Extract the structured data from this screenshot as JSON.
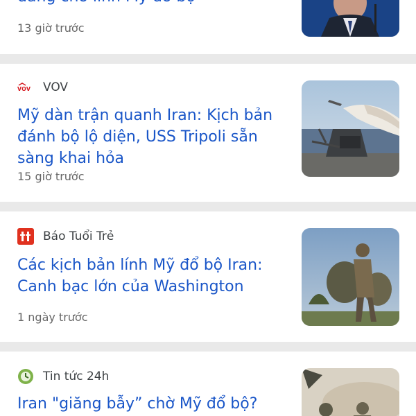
{
  "articles": [
    {
      "source": "",
      "headline": "đang cho lính Mỹ đổ bộ",
      "time": "13 giờ trước",
      "image": "man-in-suit-at-microphone"
    },
    {
      "source": "VOV",
      "source_icon": "vov-logo-icon",
      "headline": "Mỹ dàn trận quanh Iran: Kịch bản đánh bộ lộ diện, USS Tripoli sẵn sàng khai hỏa",
      "time": "15 giờ trước",
      "image": "missile-launch-from-warship"
    },
    {
      "source": "Báo Tuổi Trẻ",
      "source_icon": "tuoi-tre-logo-icon",
      "headline": "Các kịch bản lính Mỹ đổ bộ Iran: Canh bạc lớn của Washington",
      "time": "1 ngày trước",
      "image": "soldiers-with-backpacks"
    },
    {
      "source": "Tin tức 24h",
      "source_icon": "tin-tuc-24h-logo-icon",
      "headline": "Iran \"giăng bẫy” chờ Mỹ đổ bộ?",
      "time": "",
      "image": "soldiers-in-dust"
    }
  ],
  "colors": {
    "headline": "#1a56c8",
    "meta": "#666666",
    "divider": "#e9e9e9",
    "vov_red": "#d71920",
    "tuoitre_red": "#e0311f",
    "tintuc_green": "#5a8c3a"
  }
}
